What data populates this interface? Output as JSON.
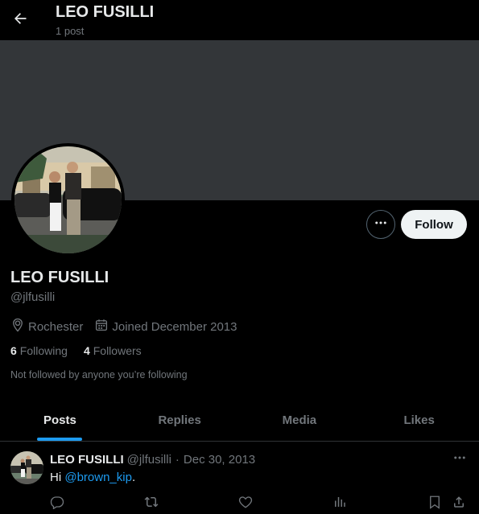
{
  "topbar": {
    "title": "LEO FUSILLI",
    "subtitle": "1 post",
    "back_icon": "arrow-left-icon"
  },
  "profile": {
    "name": "LEO FUSILLI",
    "handle": "@jlfusilli",
    "location": "Rochester",
    "joined": "Joined December 2013",
    "following_count": "6",
    "following_label": "Following",
    "followers_count": "4",
    "followers_label": "Followers",
    "not_followed_text": "Not followed by anyone you’re following"
  },
  "actions": {
    "follow_label": "Follow",
    "more_icon": "more-horizontal-icon"
  },
  "tabs": [
    {
      "label": "Posts",
      "active": true
    },
    {
      "label": "Replies",
      "active": false
    },
    {
      "label": "Media",
      "active": false
    },
    {
      "label": "Likes",
      "active": false
    }
  ],
  "post": {
    "name": "LEO FUSILLI",
    "handle": "@jlfusilli",
    "separator": "·",
    "date": "Dec 30, 2013",
    "text_prefix": "Hi ",
    "mention": "@brown_kip",
    "text_suffix": "."
  },
  "colors": {
    "accent": "#1d9bf0",
    "background": "#000000",
    "banner": "#333639",
    "muted_text": "#71767b"
  }
}
